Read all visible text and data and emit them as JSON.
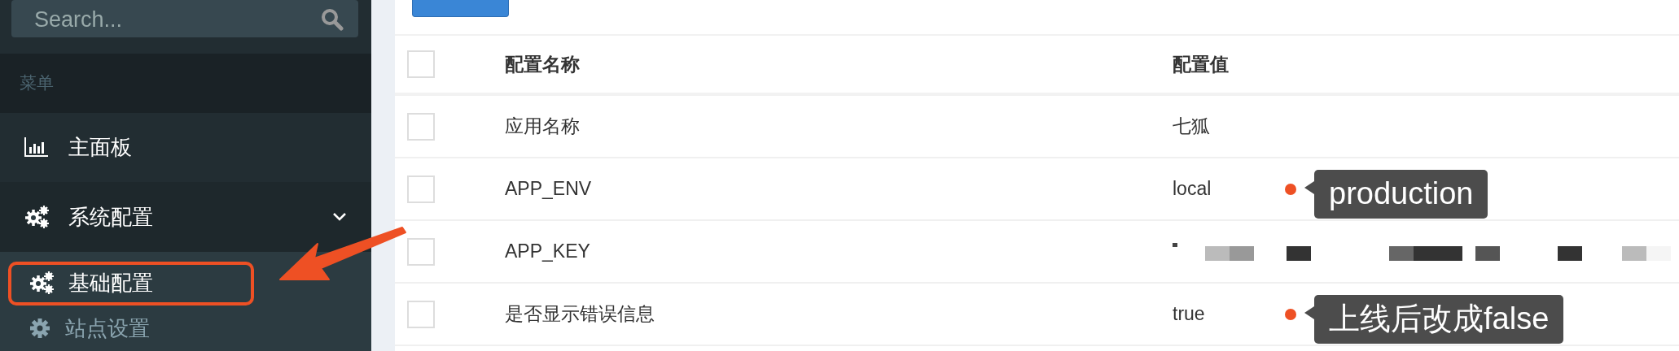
{
  "sidebar": {
    "search": {
      "placeholder": "Search..."
    },
    "menu_header": "菜单",
    "items": [
      {
        "label": "主面板",
        "expanded": false
      },
      {
        "label": "系统配置",
        "expanded": true,
        "children": [
          {
            "label": "基础配置",
            "selected": true,
            "highlighted": true
          },
          {
            "label": "站点设置",
            "selected": false,
            "highlighted": false
          }
        ]
      }
    ]
  },
  "toolbar": {
    "kind": "new-button"
  },
  "table": {
    "header_checked": false,
    "columns": [
      "配置名称",
      "配置值"
    ],
    "rows": [
      {
        "checked": false,
        "name": "应用名称",
        "value": "七狐"
      },
      {
        "checked": false,
        "name": "APP_ENV",
        "value": "local",
        "note": "production"
      },
      {
        "checked": false,
        "name": "APP_KEY"
      },
      {
        "checked": false,
        "name": "是否显示错误信息",
        "value": "true",
        "note": "上线后改成false"
      }
    ]
  }
}
